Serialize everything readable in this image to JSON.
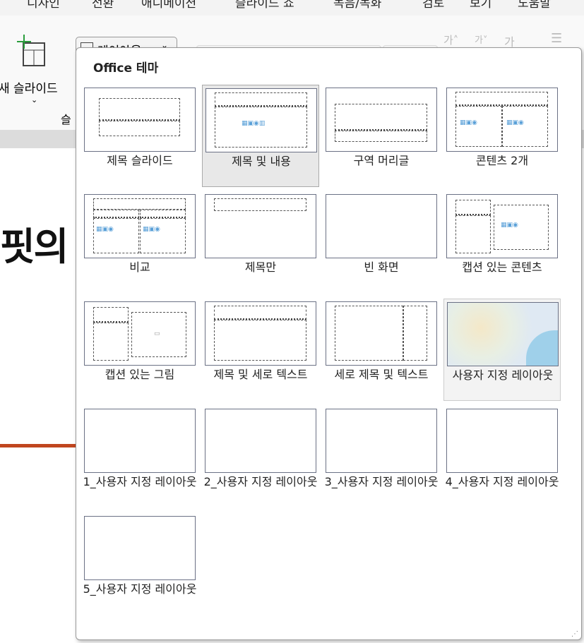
{
  "menu": [
    "디자인",
    "전환",
    "애니메이션",
    "슬라이드 쇼",
    "녹음/녹화",
    "검토",
    "보기",
    "도움말"
  ],
  "ribbon": {
    "new_slide": "새 슬라이드",
    "layout_button": "레이아웃",
    "font_size": "44",
    "group_label": "슬"
  },
  "slide_text": "핏의",
  "popup": {
    "title": "Office 테마",
    "items": [
      {
        "label": "제목 슬라이드"
      },
      {
        "label": "제목 및 내용"
      },
      {
        "label": "구역 머리글"
      },
      {
        "label": "콘텐츠 2개"
      },
      {
        "label": "비교"
      },
      {
        "label": "제목만"
      },
      {
        "label": "빈 화면"
      },
      {
        "label": "캡션 있는 콘텐츠"
      },
      {
        "label": "캡션 있는 그림"
      },
      {
        "label": "제목 및 세로 텍스트"
      },
      {
        "label": "세로 제목 및 텍스트"
      },
      {
        "label": "사용자 지정 레이아웃"
      },
      {
        "label": "1_사용자 지정 레이아웃"
      },
      {
        "label": "2_사용자 지정 레이아웃"
      },
      {
        "label": "3_사용자 지정 레이아웃"
      },
      {
        "label": "4_사용자 지정 레이아웃"
      },
      {
        "label": "5_사용자 지정 레이아웃"
      }
    ]
  },
  "selected": "제목 및 내용"
}
